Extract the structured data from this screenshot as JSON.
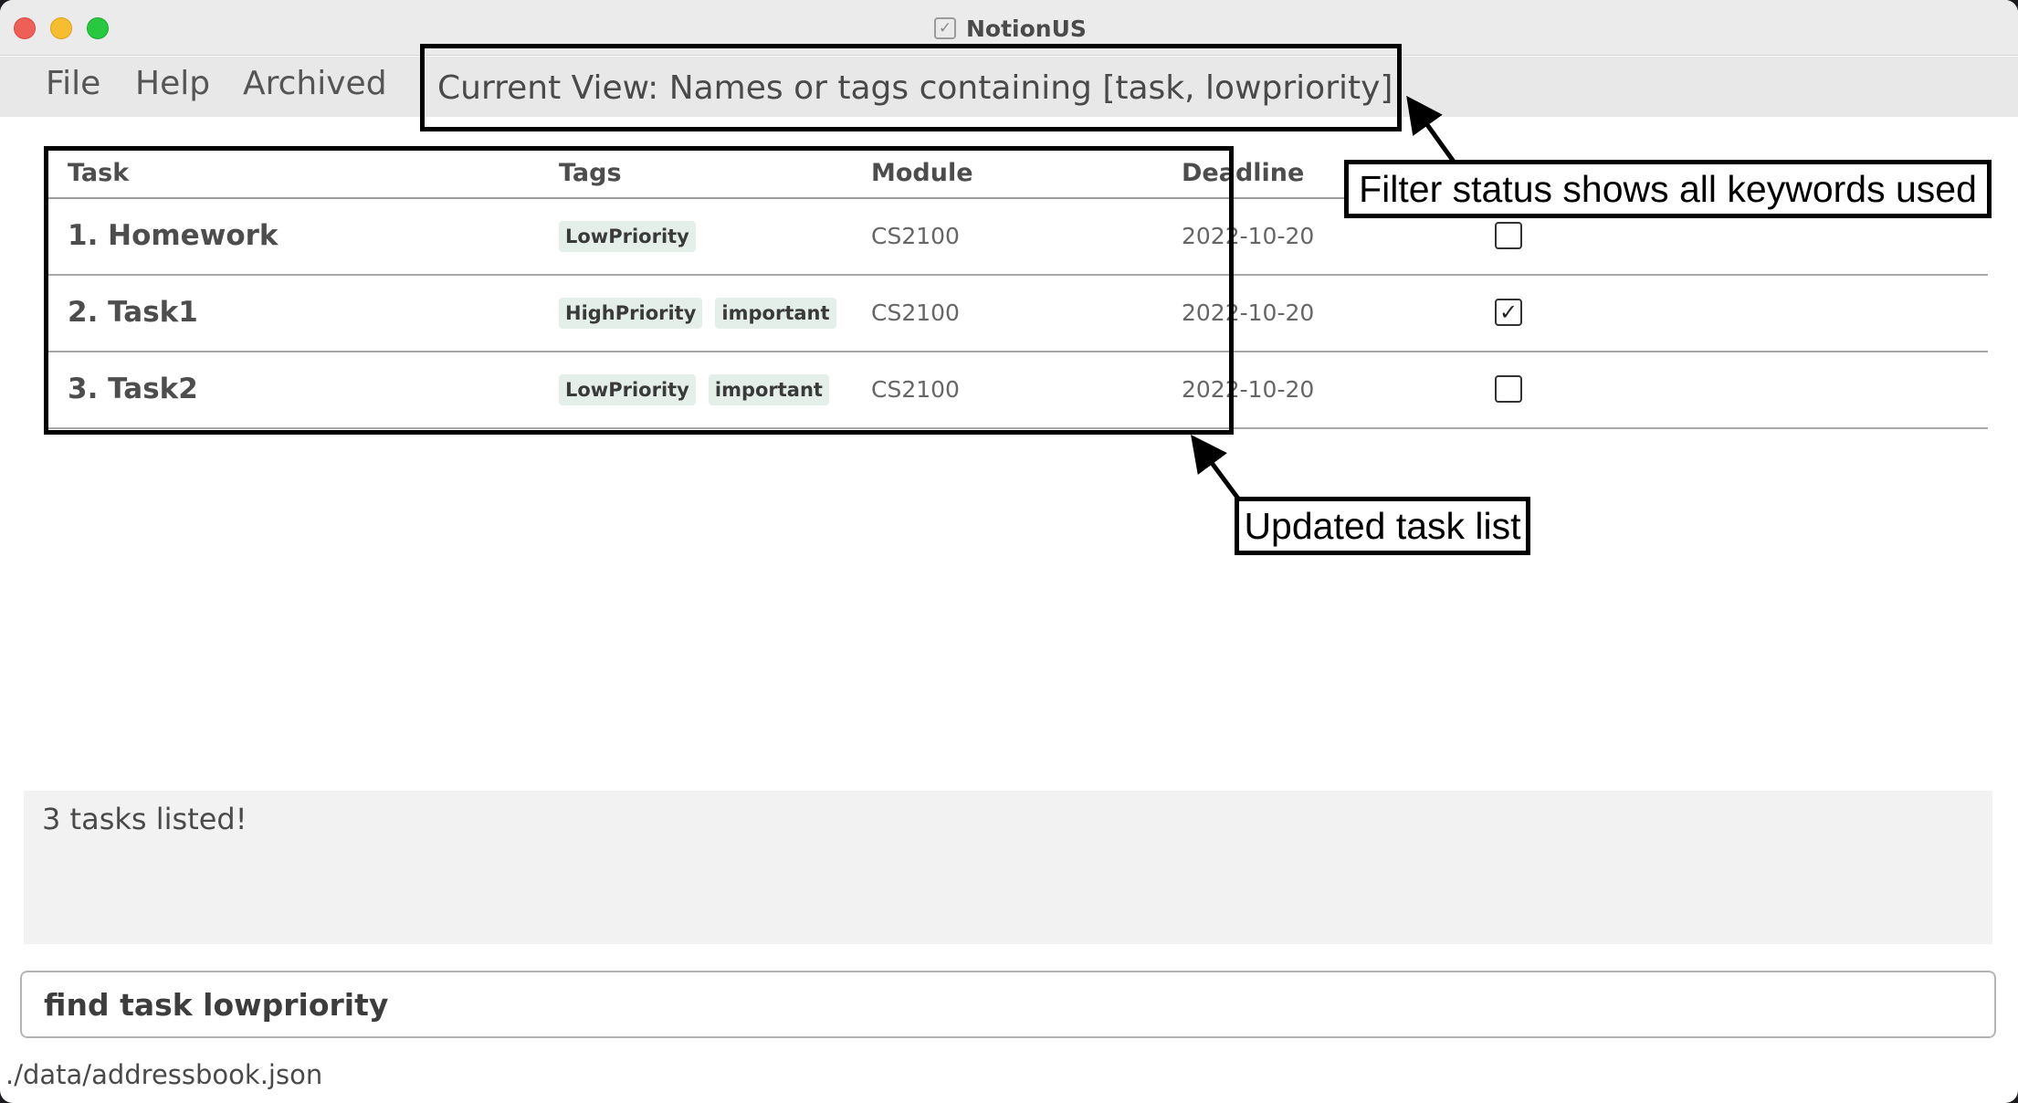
{
  "window": {
    "title": "NotionUS",
    "app_icon": "checkbox-icon"
  },
  "menu": {
    "file": "File",
    "help": "Help",
    "archived": "Archived",
    "current_view": "Current View: Names or tags containing [task, lowpriority]"
  },
  "table": {
    "headers": [
      "Task",
      "Tags",
      "Module",
      "Deadline"
    ],
    "rows": [
      {
        "name": "1. Homework",
        "tags": [
          "LowPriority"
        ],
        "module": "CS2100",
        "deadline": "2022-10-20",
        "done": false
      },
      {
        "name": "2. Task1",
        "tags": [
          "HighPriority",
          "important"
        ],
        "module": "CS2100",
        "deadline": "2022-10-20",
        "done": true
      },
      {
        "name": "3. Task2",
        "tags": [
          "LowPriority",
          "important"
        ],
        "module": "CS2100",
        "deadline": "2022-10-20",
        "done": false
      }
    ]
  },
  "annotations": {
    "filter_status": "Filter status shows all keywords used",
    "updated_list": "Updated task list"
  },
  "result": {
    "message": "3 tasks listed!"
  },
  "command": {
    "value": "find task lowpriority"
  },
  "status": {
    "file_path": "./data/addressbook.json"
  },
  "colors": {
    "tag_background": "#e4efea",
    "menubar": "#e8e8e8",
    "result_background": "#f2f2f2"
  }
}
